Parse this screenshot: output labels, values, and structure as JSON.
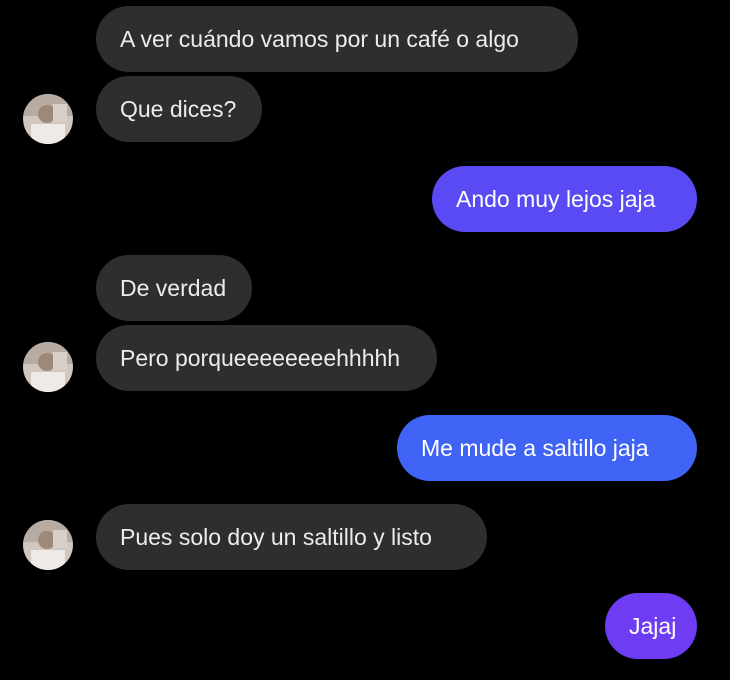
{
  "conversation": {
    "messages": [
      {
        "id": "m1",
        "direction": "incoming",
        "text": "A ver cuándo vamos por un café o algo"
      },
      {
        "id": "m2",
        "direction": "incoming",
        "text": "Que dices?"
      },
      {
        "id": "m3",
        "direction": "outgoing",
        "text": "Ando muy lejos jaja"
      },
      {
        "id": "m4",
        "direction": "incoming",
        "text": "De verdad"
      },
      {
        "id": "m5",
        "direction": "incoming",
        "text": "Pero porqueeeeeeeehhhhh"
      },
      {
        "id": "m6",
        "direction": "outgoing",
        "text": "Me mude a saltillo jaja"
      },
      {
        "id": "m7",
        "direction": "incoming",
        "text": "Pues solo doy un saltillo y listo"
      },
      {
        "id": "m8",
        "direction": "outgoing",
        "text": "Jajaj"
      }
    ]
  },
  "colors": {
    "background": "#000000",
    "incoming_bubble": "#2e2e2f",
    "outgoing_gradient_top": "#6a3cf2",
    "outgoing_gradient_bottom": "#3b66f5"
  }
}
